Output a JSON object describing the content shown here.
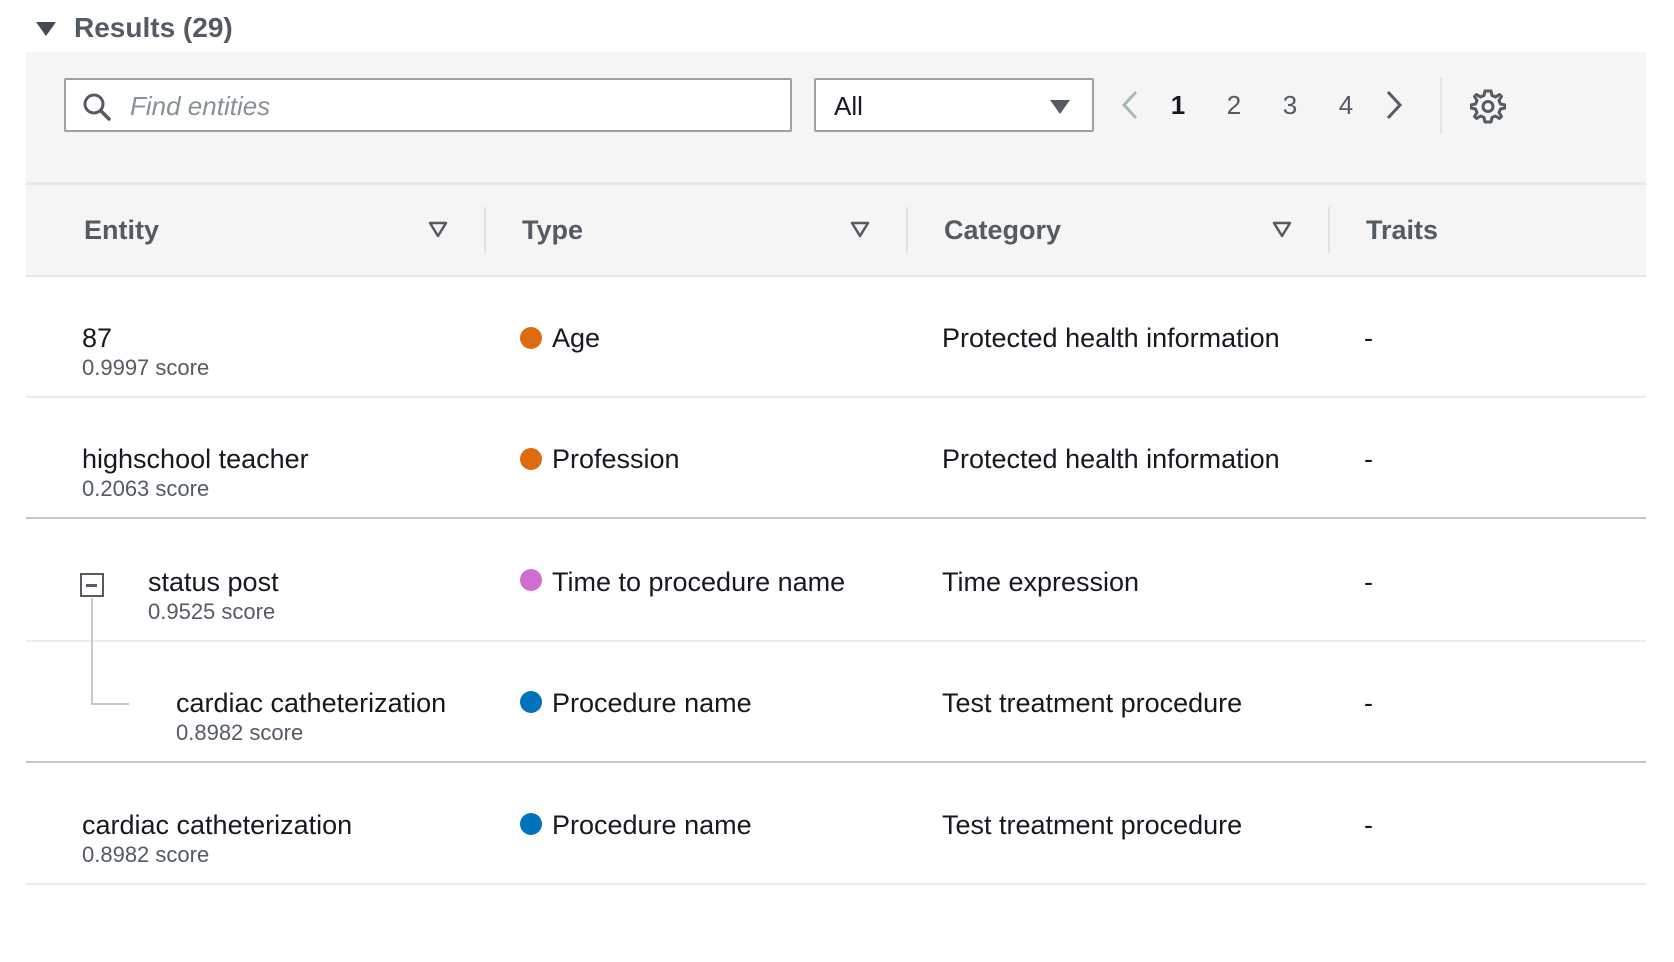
{
  "header": {
    "title": "Results (29)"
  },
  "search": {
    "placeholder": "Find entities",
    "value": ""
  },
  "filter": {
    "selected": "All"
  },
  "pagination": {
    "pages": [
      "1",
      "2",
      "3",
      "4"
    ],
    "current": "1"
  },
  "columns": {
    "entity": "Entity",
    "type": "Type",
    "category": "Category",
    "traits": "Traits"
  },
  "colors": {
    "orange": "#dd6b10",
    "pink": "#d16fd0",
    "blue": "#0073bb"
  },
  "rows": [
    {
      "entity": "87",
      "score": "0.9997 score",
      "type": "Age",
      "type_color": "orange",
      "category": "Protected health information",
      "traits": "-"
    },
    {
      "entity": "highschool teacher",
      "score": "0.2063 score",
      "type": "Profession",
      "type_color": "orange",
      "category": "Protected health information",
      "traits": "-"
    },
    {
      "entity": "status post",
      "score": "0.9525 score",
      "type": "Time to procedure name",
      "type_color": "pink",
      "category": "Time expression",
      "traits": "-"
    },
    {
      "entity": "cardiac catheterization",
      "score": "0.8982 score",
      "type": "Procedure name",
      "type_color": "blue",
      "category": "Test treatment procedure",
      "traits": "-"
    },
    {
      "entity": "cardiac catheterization",
      "score": "0.8982 score",
      "type": "Procedure name",
      "type_color": "blue",
      "category": "Test treatment procedure",
      "traits": "-"
    }
  ]
}
